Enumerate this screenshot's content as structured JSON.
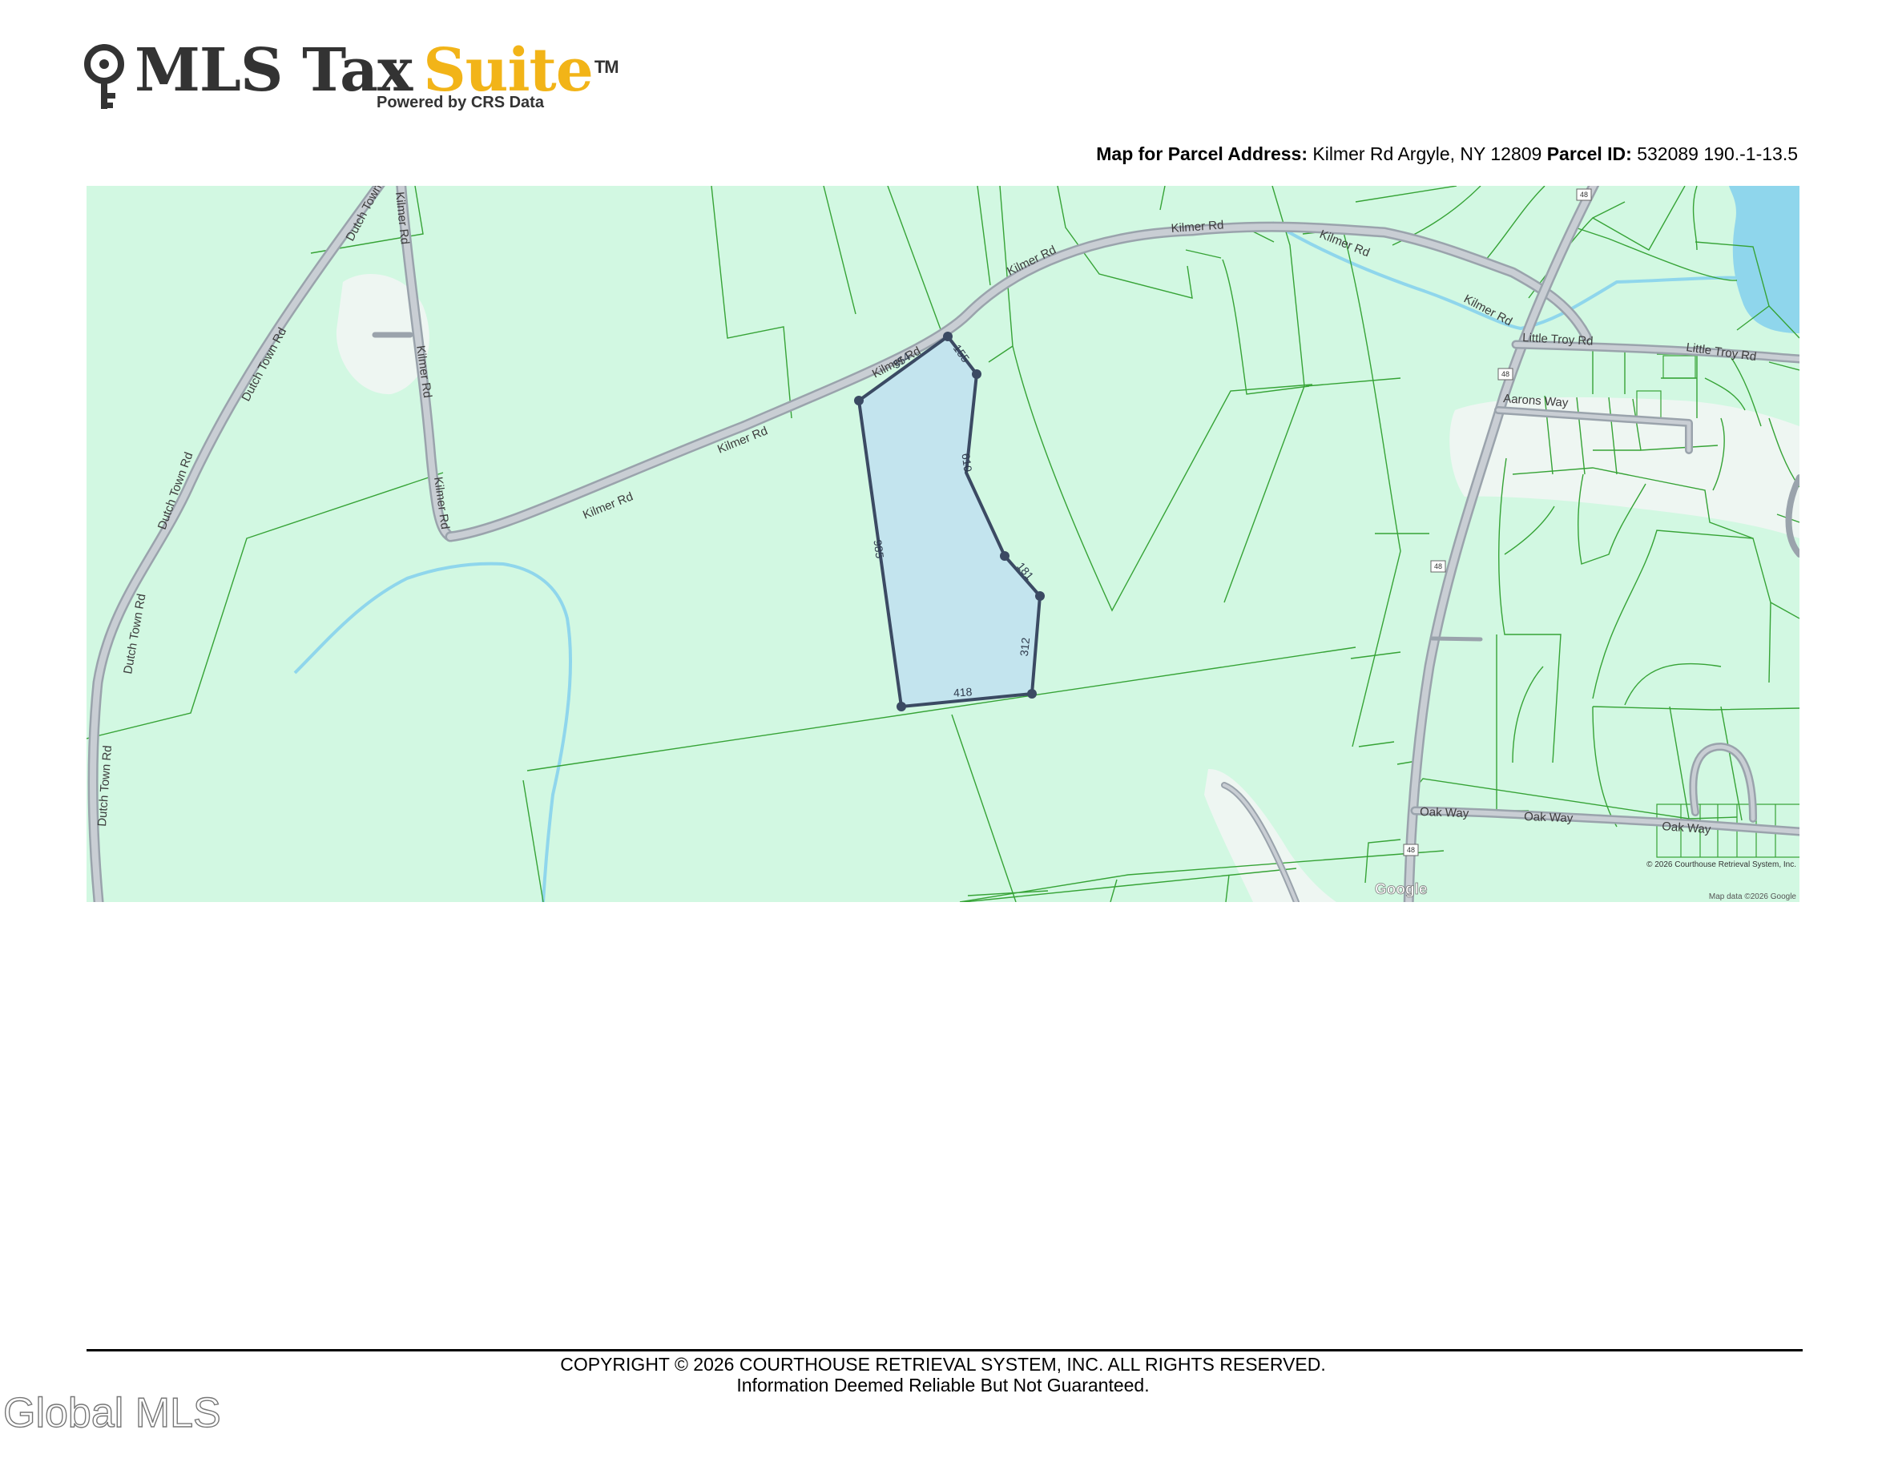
{
  "logo": {
    "brand_primary": "MLS Tax",
    "brand_accent": "Suite",
    "trademark": "TM",
    "tagline": "Powered by CRS Data",
    "accent_color": "#f2b418"
  },
  "header": {
    "address_label": "Map for Parcel Address:",
    "address_value": "Kilmer Rd Argyle, NY 12809",
    "parcel_label": "Parcel ID:",
    "parcel_value": "532089 190.-1-13.5"
  },
  "map": {
    "colors": {
      "land": "#d2f8e2",
      "parcel_fill": "#c3e4ee",
      "parcel_stroke": "#3b4a63",
      "water": "#8fd6ec",
      "road": "#b4bcc5",
      "boundary": "#36a336"
    },
    "roads": {
      "kilmer_rd": "Kilmer Rd",
      "dutch_town_rd": "Dutch Town Rd",
      "little_troy_rd": "Little Troy Rd",
      "aarons_way": "Aarons Way",
      "oak_way": "Oak Way",
      "route_48": "48"
    },
    "parcel_dimensions": [
      "155",
      "354",
      "610",
      "181",
      "312",
      "418",
      "985"
    ],
    "attribution": {
      "google": "Google",
      "courthouse": "© 2026 Courthouse Retrieval System, Inc.",
      "map_data": "Map data ©2026 Google"
    }
  },
  "footer": {
    "copyright": "COPYRIGHT © 2026 COURTHOUSE RETRIEVAL SYSTEM, INC. ALL RIGHTS RESERVED.",
    "disclaimer": "Information Deemed Reliable But Not Guaranteed."
  },
  "watermark": "Global MLS"
}
